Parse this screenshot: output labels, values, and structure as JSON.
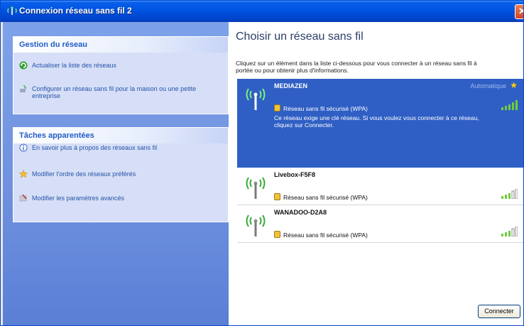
{
  "window": {
    "title": "Connexion réseau sans fil 2"
  },
  "left_pane": {
    "network_tasks": {
      "header": "Gestion du réseau",
      "items": [
        {
          "icon": "refresh-icon",
          "label": "Actualiser la liste des réseaux"
        },
        {
          "icon": "setup-network-icon",
          "label_line1": "Configurer un réseau sans fil pour la maison ou une petite",
          "label_line2": "entreprise"
        }
      ]
    },
    "related_tasks": {
      "header": "Tâches apparentées",
      "items": [
        {
          "icon": "info-icon",
          "label": "En savoir plus à propos des réseaux sans fil"
        },
        {
          "icon": "star-icon",
          "label": "Modifier l'ordre des réseaux préférés"
        },
        {
          "icon": "settings-icon",
          "label": "Modifier les paramètres avancés"
        }
      ]
    }
  },
  "right_pane": {
    "title": "Choisir un réseau sans fil",
    "instructions_line1": "Cliquez sur un élément dans la liste ci-dessous pour vous connecter à un réseau sans fil à",
    "instructions_line2": "portée ou pour obtenir plus d'informations.",
    "networks": [
      {
        "ssid": "MEDIAZEN",
        "mode": "Automatique",
        "security": "Réseau sans fil sécurisé (WPA)",
        "description_line1": "Ce réseau exige une clé réseau. Si vous voulez vous connecter à ce réseau,",
        "description_line2": "cliquez sur Connecter.",
        "signal": 5,
        "selected": true
      },
      {
        "ssid": "Livebox-F5F8",
        "security": "Réseau sans fil sécurisé (WPA)",
        "signal": 3,
        "selected": false
      },
      {
        "ssid": "WANADOO-D2A8",
        "security": "Réseau sans fil sécurisé (WPA)",
        "signal": 3,
        "selected": false
      }
    ],
    "connect_button": "Connecter"
  },
  "colors": {
    "titlebar": "#0055e5",
    "left_pane": "#6f91de",
    "selected_item": "#2f5fc4",
    "signal_active": "#6fcf3a"
  }
}
